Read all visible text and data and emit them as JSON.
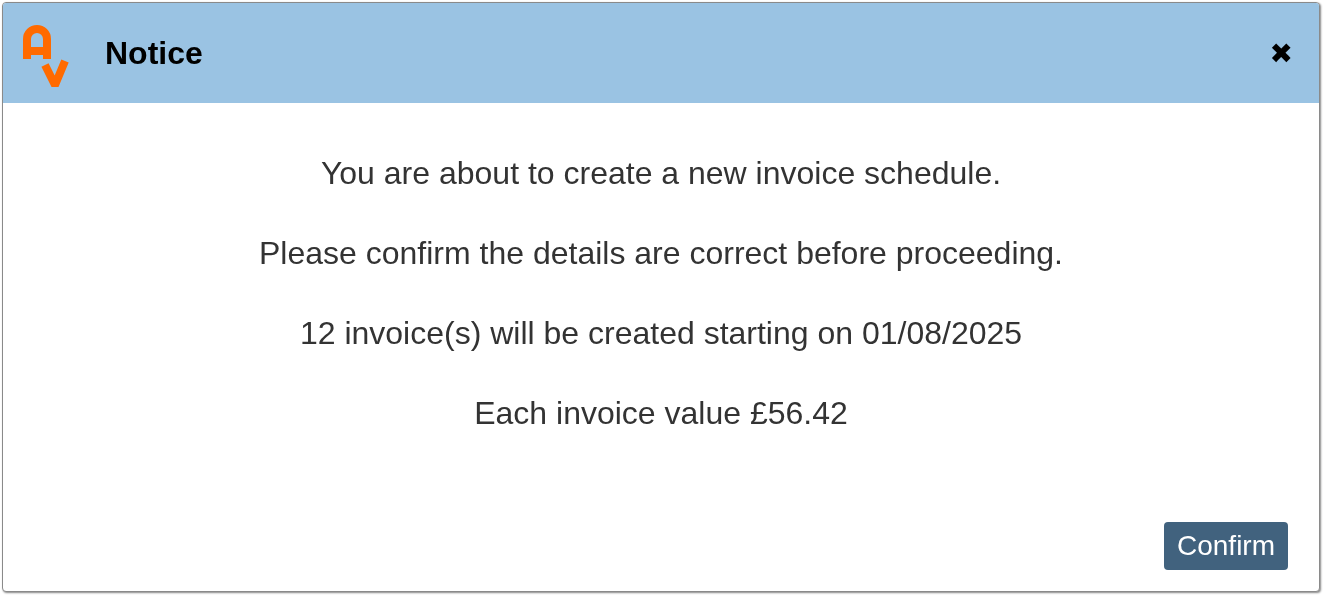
{
  "dialog": {
    "title": "Notice",
    "close": "✖",
    "paragraphs": [
      "You are about to create a new invoice schedule.",
      "Please confirm the details are correct before proceeding.",
      "12 invoice(s) will be created starting on 01/08/2025",
      "Each invoice value £56.42"
    ],
    "buttons": [
      "Confirm"
    ]
  }
}
